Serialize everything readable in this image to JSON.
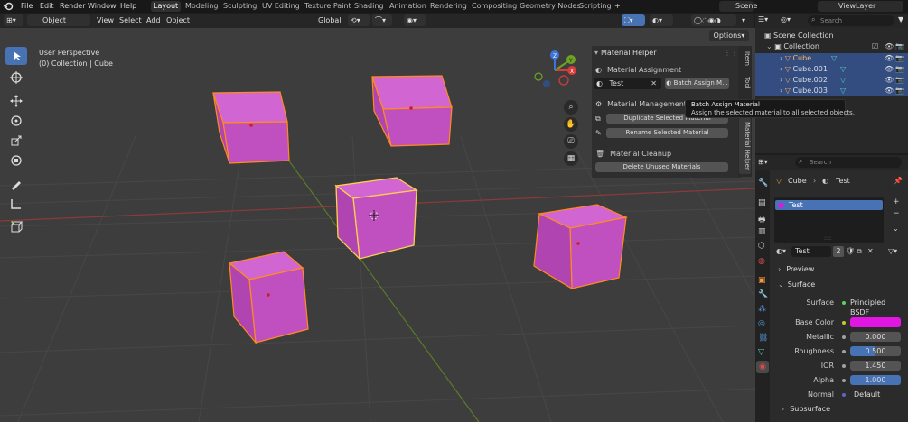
{
  "menu": {
    "file": "File",
    "edit": "Edit",
    "render": "Render",
    "window": "Window",
    "help": "Help"
  },
  "workspaces": [
    "Layout",
    "Modeling",
    "Sculpting",
    "UV Editing",
    "Texture Paint",
    "Shading",
    "Animation",
    "Rendering",
    "Compositing",
    "Geometry Nodes",
    "Scripting"
  ],
  "scene": {
    "name": "Scene",
    "view_layer": "ViewLayer"
  },
  "viewport_header": {
    "mode": "Object Mode",
    "view": "View",
    "select": "Select",
    "add": "Add",
    "object": "Object",
    "orientation": "Global",
    "options": "Options"
  },
  "viewport": {
    "perspective": "User Perspective",
    "collection_info": "(0) Collection | Cube"
  },
  "material_helper": {
    "title": "Material Helper",
    "assignment_label": "Material Assignment",
    "material_name": "Test",
    "batch_button": "Batch Assign M...",
    "management_label": "Material Management",
    "duplicate_button": "Duplicate Selected Material",
    "rename_button": "Rename Selected Material",
    "cleanup_label": "Material Cleanup",
    "delete_button": "Delete Unused Materials"
  },
  "tooltip": {
    "title": "Batch Assign Material",
    "description": "Assign the selected material to all selected objects."
  },
  "sidebar_tabs": [
    "Item",
    "Tool",
    "Material Helper"
  ],
  "outliner": {
    "search_placeholder": "Search",
    "scene_collection": "Scene Collection",
    "collection": "Collection",
    "items": [
      "Cube",
      "Cube.001",
      "Cube.002",
      "Cube.003"
    ]
  },
  "properties": {
    "search_placeholder": "Search",
    "breadcrumb_object": "Cube",
    "breadcrumb_material": "Test",
    "slot_name": "Test",
    "material_name": "Test",
    "user_count": "2",
    "preview": "Preview",
    "surface": "Surface",
    "surface_label": "Surface",
    "surface_value": "Principled BSDF",
    "base_color_label": "Base Color",
    "base_color": "#e216e2",
    "metallic_label": "Metallic",
    "metallic": "0.000",
    "roughness_label": "Roughness",
    "roughness": "0.500",
    "ior_label": "IOR",
    "ior": "1.450",
    "alpha_label": "Alpha",
    "alpha": "1.000",
    "normal_label": "Normal",
    "normal": "Default",
    "subsurface": "Subsurface"
  },
  "colors": {
    "accent": "#4772b3",
    "selection": "#334d80",
    "cube_face": "#c04fc0",
    "cube_outline": "#ff8c1a",
    "active_outline": "#ffd04d"
  }
}
